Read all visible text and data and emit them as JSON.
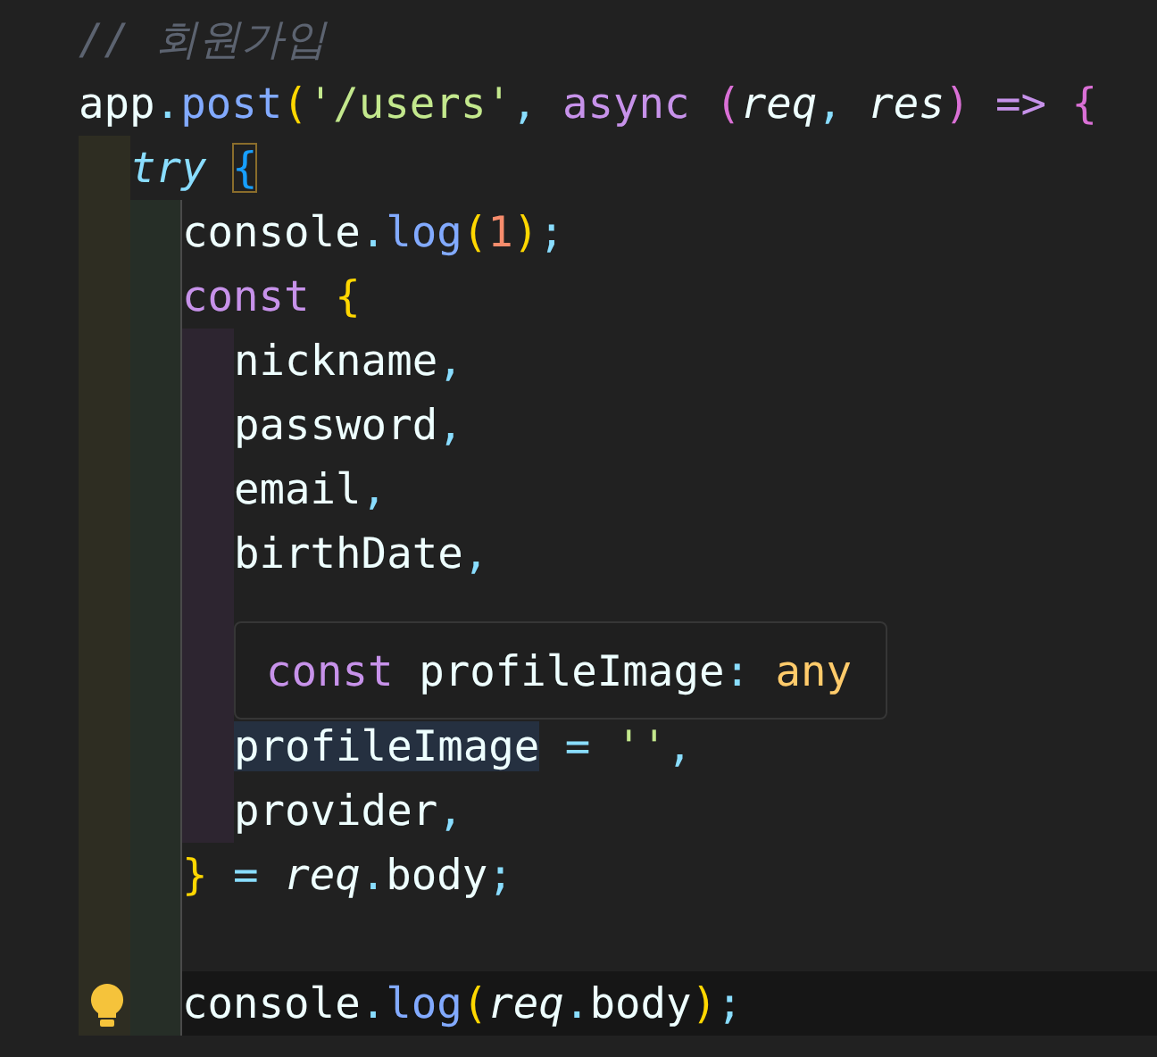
{
  "editor": {
    "lines": [
      {
        "kind": "code",
        "tokens": [
          {
            "text": "// 회원가입",
            "kind": "comment"
          }
        ]
      },
      {
        "kind": "code",
        "tokens": [
          {
            "text": "app",
            "kind": "plain"
          },
          {
            "text": ".",
            "kind": "punct"
          },
          {
            "text": "post",
            "kind": "function"
          },
          {
            "text": "(",
            "kind": "bracket1"
          },
          {
            "text": "'/users'",
            "kind": "string"
          },
          {
            "text": ", ",
            "kind": "punct"
          },
          {
            "text": "async ",
            "kind": "keyword"
          },
          {
            "text": "(",
            "kind": "bracket2"
          },
          {
            "text": "req",
            "kind": "param"
          },
          {
            "text": ", ",
            "kind": "punct"
          },
          {
            "text": "res",
            "kind": "param"
          },
          {
            "text": ") ",
            "kind": "bracket2"
          },
          {
            "text": "=> ",
            "kind": "keyword"
          },
          {
            "text": "{",
            "kind": "bracket2"
          }
        ],
        "children": [
          {
            "kind": "code",
            "tokens": [
              {
                "text": "try ",
                "kind": "control"
              },
              {
                "text": "{",
                "kind": "bracket-match"
              }
            ],
            "children": [
              {
                "kind": "code",
                "tokens": [
                  {
                    "text": "console",
                    "kind": "plain"
                  },
                  {
                    "text": ".",
                    "kind": "punct"
                  },
                  {
                    "text": "log",
                    "kind": "function"
                  },
                  {
                    "text": "(",
                    "kind": "bracket1"
                  },
                  {
                    "text": "1",
                    "kind": "number"
                  },
                  {
                    "text": ")",
                    "kind": "bracket1"
                  },
                  {
                    "text": ";",
                    "kind": "punct"
                  }
                ]
              },
              {
                "kind": "code",
                "tokens": [
                  {
                    "text": "const ",
                    "kind": "keyword"
                  },
                  {
                    "text": "{",
                    "kind": "bracket1"
                  }
                ],
                "children": [
                  {
                    "kind": "code",
                    "tokens": [
                      {
                        "text": "nickname",
                        "kind": "plain"
                      },
                      {
                        "text": ",",
                        "kind": "punct"
                      }
                    ]
                  },
                  {
                    "kind": "code",
                    "tokens": [
                      {
                        "text": "password",
                        "kind": "plain"
                      },
                      {
                        "text": ",",
                        "kind": "punct"
                      }
                    ]
                  },
                  {
                    "kind": "code",
                    "tokens": [
                      {
                        "text": "email",
                        "kind": "plain"
                      },
                      {
                        "text": ",",
                        "kind": "punct"
                      }
                    ]
                  },
                  {
                    "kind": "code",
                    "tokens": [
                      {
                        "text": "birthDate",
                        "kind": "plain"
                      },
                      {
                        "text": ",",
                        "kind": "punct"
                      }
                    ]
                  },
                  {
                    "kind": "blank"
                  },
                  {
                    "kind": "blank"
                  },
                  {
                    "kind": "code",
                    "tokens": [
                      {
                        "text": "profileImage",
                        "kind": "var-highlight"
                      },
                      {
                        "text": " = ",
                        "kind": "operator"
                      },
                      {
                        "text": "''",
                        "kind": "string"
                      },
                      {
                        "text": ",",
                        "kind": "punct"
                      }
                    ]
                  },
                  {
                    "kind": "code",
                    "tokens": [
                      {
                        "text": "provider",
                        "kind": "plain"
                      },
                      {
                        "text": ",",
                        "kind": "punct"
                      }
                    ]
                  }
                ]
              },
              {
                "kind": "code",
                "tokens": [
                  {
                    "text": "} ",
                    "kind": "bracket1"
                  },
                  {
                    "text": "= ",
                    "kind": "operator"
                  },
                  {
                    "text": "req",
                    "kind": "param"
                  },
                  {
                    "text": ".",
                    "kind": "punct"
                  },
                  {
                    "text": "body",
                    "kind": "plain"
                  },
                  {
                    "text": ";",
                    "kind": "punct"
                  }
                ]
              },
              {
                "kind": "blank"
              },
              {
                "kind": "code",
                "tokens": [
                  {
                    "text": "console",
                    "kind": "plain"
                  },
                  {
                    "text": ".",
                    "kind": "punct"
                  },
                  {
                    "text": "log",
                    "kind": "function"
                  },
                  {
                    "text": "(",
                    "kind": "bracket1"
                  },
                  {
                    "text": "req",
                    "kind": "param"
                  },
                  {
                    "text": ".",
                    "kind": "punct"
                  },
                  {
                    "text": "body",
                    "kind": "plain"
                  },
                  {
                    "text": ")",
                    "kind": "bracket1"
                  },
                  {
                    "text": ";",
                    "kind": "punct"
                  }
                ],
                "current": true,
                "lightbulb": true
              }
            ]
          }
        ]
      }
    ]
  },
  "hover": {
    "tokens": [
      {
        "text": "const ",
        "kind": "keyword"
      },
      {
        "text": "profileImage",
        "kind": "plain"
      },
      {
        "text": ": ",
        "kind": "punct"
      },
      {
        "text": "any",
        "kind": "type"
      }
    ]
  }
}
